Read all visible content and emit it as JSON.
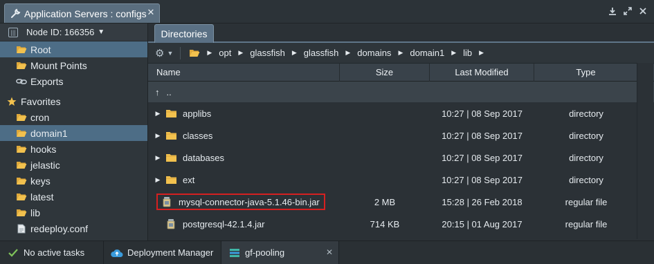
{
  "window": {
    "title": "Application Servers : configs",
    "close_label": "✕"
  },
  "sidebar": {
    "node_label": "Node ID: 166356",
    "items": [
      {
        "label": "Root",
        "icon": "folder-open-icon",
        "selected": true
      },
      {
        "label": "Mount Points",
        "icon": "folder-icon"
      },
      {
        "label": "Exports",
        "icon": "link-icon"
      }
    ],
    "favorites_label": "Favorites",
    "favorites": [
      {
        "label": "cron"
      },
      {
        "label": "domain1",
        "selected": true
      },
      {
        "label": "hooks"
      },
      {
        "label": "jelastic"
      },
      {
        "label": "keys"
      },
      {
        "label": "latest"
      },
      {
        "label": "lib"
      },
      {
        "label": "redeploy.conf"
      }
    ]
  },
  "panel": {
    "tab": "Directories",
    "breadcrumb": [
      "opt",
      "glassfish",
      "glassfish",
      "domains",
      "domain1",
      "lib"
    ],
    "columns": {
      "name": "Name",
      "size": "Size",
      "modified": "Last Modified",
      "type": "Type"
    },
    "up_label": "..",
    "rows": [
      {
        "name": "applibs",
        "size": "",
        "modified": "10:27 | 08 Sep 2017",
        "type": "directory",
        "kind": "dir"
      },
      {
        "name": "classes",
        "size": "",
        "modified": "10:27 | 08 Sep 2017",
        "type": "directory",
        "kind": "dir"
      },
      {
        "name": "databases",
        "size": "",
        "modified": "10:27 | 08 Sep 2017",
        "type": "directory",
        "kind": "dir"
      },
      {
        "name": "ext",
        "size": "",
        "modified": "10:27 | 08 Sep 2017",
        "type": "directory",
        "kind": "dir"
      },
      {
        "name": "mysql-connector-java-5.1.46-bin.jar",
        "size": "2 MB",
        "modified": "15:28 | 26 Feb 2018",
        "type": "regular file",
        "kind": "jar",
        "highlighted": true
      },
      {
        "name": "postgresql-42.1.4.jar",
        "size": "714 KB",
        "modified": "20:15 | 01 Aug 2017",
        "type": "regular file",
        "kind": "jar"
      }
    ]
  },
  "statusbar": {
    "tasks": "No active tasks",
    "deployment": "Deployment Manager",
    "env": "gf-pooling"
  },
  "colors": {
    "selection": "#4d6d86",
    "highlight_border": "#d62020",
    "folder": "#f2c14e"
  }
}
